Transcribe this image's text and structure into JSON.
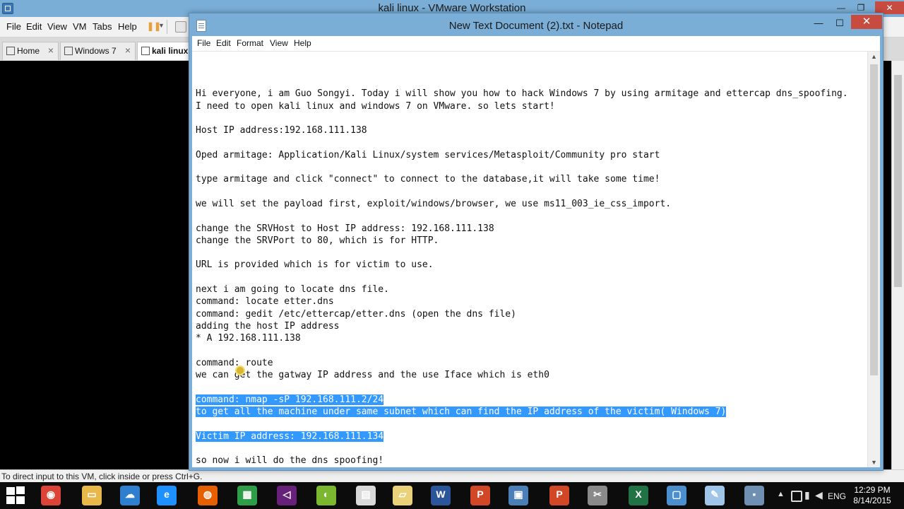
{
  "vmware": {
    "title": "kali linux - VMware Workstation",
    "window_controls": {
      "minimize": "—",
      "restore": "❐",
      "close": "✕"
    },
    "menu": [
      "File",
      "Edit",
      "View",
      "VM",
      "Tabs",
      "Help"
    ],
    "pause_icon": "pause-icon",
    "tabs": [
      {
        "label": "Home",
        "close": "×",
        "active": false
      },
      {
        "label": "Windows 7",
        "close": "×",
        "active": false
      },
      {
        "label": "kali linux",
        "close": "×",
        "active": true
      }
    ],
    "status_text": "To direct input to this VM, click inside or press Ctrl+G."
  },
  "notepad": {
    "title": "New Text Document (2).txt - Notepad",
    "window_controls": {
      "minimize": "—",
      "maximize": "☐",
      "close": "✕"
    },
    "menu": [
      "File",
      "Edit",
      "Format",
      "View",
      "Help"
    ],
    "lines": [
      {
        "text": "",
        "selected": false
      },
      {
        "text": "Hi everyone, i am Guo Songyi. Today i will show you how to hack Windows 7 by using armitage and ettercap dns_spoofing.",
        "selected": false
      },
      {
        "text": "I need to open kali linux and windows 7 on VMware. so lets start!",
        "selected": false
      },
      {
        "text": "",
        "selected": false
      },
      {
        "text": "Host IP address:192.168.111.138",
        "selected": false
      },
      {
        "text": "",
        "selected": false
      },
      {
        "text": "Oped armitage: Application/Kali Linux/system services/Metasploit/Community pro start",
        "selected": false
      },
      {
        "text": "",
        "selected": false
      },
      {
        "text": "type armitage and click \"connect\" to connect to the database,it will take some time!",
        "selected": false
      },
      {
        "text": "",
        "selected": false
      },
      {
        "text": "we will set the payload first, exploit/windows/browser, we use ms11_003_ie_css_import.",
        "selected": false
      },
      {
        "text": "",
        "selected": false
      },
      {
        "text": "change the SRVHost to Host IP address: 192.168.111.138",
        "selected": false
      },
      {
        "text": "change the SRVPort to 80, which is for HTTP.",
        "selected": false
      },
      {
        "text": "",
        "selected": false
      },
      {
        "text": "URL is provided which is for victim to use.",
        "selected": false
      },
      {
        "text": "",
        "selected": false
      },
      {
        "text": "next i am going to locate dns file.",
        "selected": false
      },
      {
        "text": "command: locate etter.dns",
        "selected": false
      },
      {
        "text": "command: gedit /etc/ettercap/etter.dns (open the dns file)",
        "selected": false
      },
      {
        "text": "adding the host IP address",
        "selected": false
      },
      {
        "text": "* A 192.168.111.138",
        "selected": false
      },
      {
        "text": "",
        "selected": false
      },
      {
        "text": "command: route",
        "selected": false
      },
      {
        "text": "we can get the gatway IP address and the use Iface which is eth0",
        "selected": false
      },
      {
        "text": "",
        "selected": false
      },
      {
        "text": "command: nmap -sP 192.168.111.2/24",
        "selected": true
      },
      {
        "text": "to get all the machine under same subnet which can find the IP address of the victim( Windows 7)",
        "selected": true
      },
      {
        "text": "",
        "selected": true
      },
      {
        "text": "Victim IP address: 192.168.111.134",
        "selected": true
      },
      {
        "text": "",
        "selected": false
      },
      {
        "text": "so now i will do the dns spoofing!",
        "selected": false
      }
    ],
    "selection_color": "#3399ff"
  },
  "taskbar": {
    "icons": [
      {
        "name": "chrome-icon",
        "color": "#db4437",
        "glyph": "◉"
      },
      {
        "name": "file-explorer-icon",
        "color": "#e8b84a",
        "glyph": "▭"
      },
      {
        "name": "onedrive-icon",
        "color": "#2f7fd1",
        "glyph": "☁"
      },
      {
        "name": "internet-explorer-icon",
        "color": "#1e90ff",
        "glyph": "e"
      },
      {
        "name": "firefox-icon",
        "color": "#e66000",
        "glyph": "◍"
      },
      {
        "name": "store-icon",
        "color": "#2e9e48",
        "glyph": "▦"
      },
      {
        "name": "visual-studio-icon",
        "color": "#68217a",
        "glyph": "◁"
      },
      {
        "name": "green-app-icon",
        "color": "#7cb82f",
        "glyph": "◐"
      },
      {
        "name": "notepad-icon",
        "color": "#d9d9d9",
        "glyph": "▤"
      },
      {
        "name": "folder-icon",
        "color": "#e9d27a",
        "glyph": "▱"
      },
      {
        "name": "word-icon",
        "color": "#2b579a",
        "glyph": "W"
      },
      {
        "name": "powerpoint-icon",
        "color": "#d24726",
        "glyph": "P"
      },
      {
        "name": "picture-viewer-icon",
        "color": "#4a7fb8",
        "glyph": "▣"
      },
      {
        "name": "powerpoint-icon-2",
        "color": "#d24726",
        "glyph": "P"
      },
      {
        "name": "snipping-tool-icon",
        "color": "#8a8a8a",
        "glyph": "✂"
      },
      {
        "name": "excel-icon",
        "color": "#217346",
        "glyph": "X"
      },
      {
        "name": "vmware-icon",
        "color": "#4b8fcf",
        "glyph": "▢"
      },
      {
        "name": "notepad-app-icon",
        "color": "#9fc6e8",
        "glyph": "✎"
      },
      {
        "name": "floppy-save-icon",
        "color": "#6f8fb3",
        "glyph": "▪"
      }
    ],
    "tray": {
      "lang": "ENG",
      "time": "12:29 PM",
      "date": "8/14/2015"
    }
  }
}
